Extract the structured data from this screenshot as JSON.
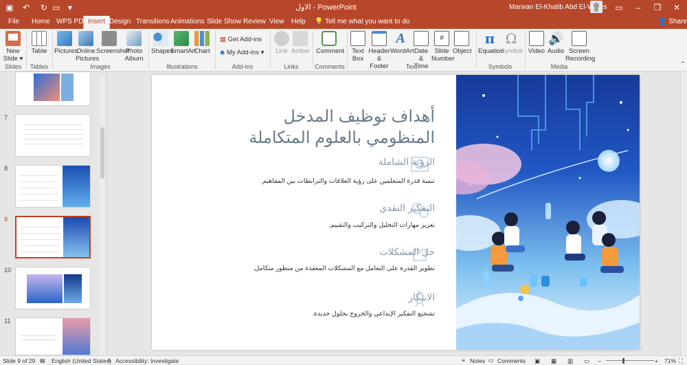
{
  "titlebar": {
    "doc_title": "الاول - PowerPoint",
    "user": "Marwan El-Khatib Abd El-Wares"
  },
  "tabs": [
    "File",
    "Home",
    "WPS PDF",
    "Insert",
    "Design",
    "Transitions",
    "Animations",
    "Slide Show",
    "Review",
    "View",
    "Help"
  ],
  "active_tab": "Insert",
  "tell_me": "Tell me what you want to do",
  "share": "Share",
  "ribbon": {
    "new_slide": "New Slide",
    "table": "Table",
    "pictures": "Pictures",
    "online_pictures": "Online Pictures",
    "screenshot": "Screenshot",
    "photo_album": "Photo Album",
    "shapes": "Shapes",
    "smartart": "SmartArt",
    "chart": "Chart",
    "get_addins": "Get Add-ins",
    "my_addins": "My Add-ins",
    "link": "Link",
    "action": "Action",
    "comment": "Comment",
    "text_box": "Text Box",
    "header_footer": "Header & Footer",
    "wordart": "WordArt",
    "date_time": "Date & Time",
    "slide_number": "Slide Number",
    "object": "Object",
    "equation": "Equation",
    "symbol": "Symbol",
    "video": "Video",
    "audio": "Audio",
    "screen_recording": "Screen Recording",
    "groups": [
      "Slides",
      "Tables",
      "Images",
      "Illustrations",
      "Add-ins",
      "Links",
      "Comments",
      "Text",
      "Symbols",
      "Media"
    ]
  },
  "thumbnails": [
    {
      "num": ""
    },
    {
      "num": "7"
    },
    {
      "num": "8"
    },
    {
      "num": "9"
    },
    {
      "num": "10"
    },
    {
      "num": "11"
    }
  ],
  "slide": {
    "title": "أهداف توظيف المدخل المنظومي بالعلوم المتكاملة",
    "items": [
      {
        "heading": "الرؤية الشاملة",
        "text": "تنمية قدرة المتعلمين على رؤية العلاقات والترابطات بين المفاهيم."
      },
      {
        "heading": "التفكير النقدي",
        "text": "تعزيز مهارات التحليل والتركيب والتقييم."
      },
      {
        "heading": "حل المشكلات",
        "text": "تطوير القدرة على التعامل مع المشكلات المعقدة من منظور متكامل."
      },
      {
        "heading": "الابتكار",
        "text": "تشجيع التفكير الإبداعي والخروج بحلول جديدة."
      }
    ]
  },
  "status": {
    "slide_info": "Slide 9 of 29",
    "language": "English (United States)",
    "accessibility": "Accessibility: Investigate",
    "notes": "Notes",
    "comments": "Comments",
    "zoom": "71%"
  },
  "colors": {
    "brand": "#b7472a",
    "selected": "#c43e1c"
  }
}
